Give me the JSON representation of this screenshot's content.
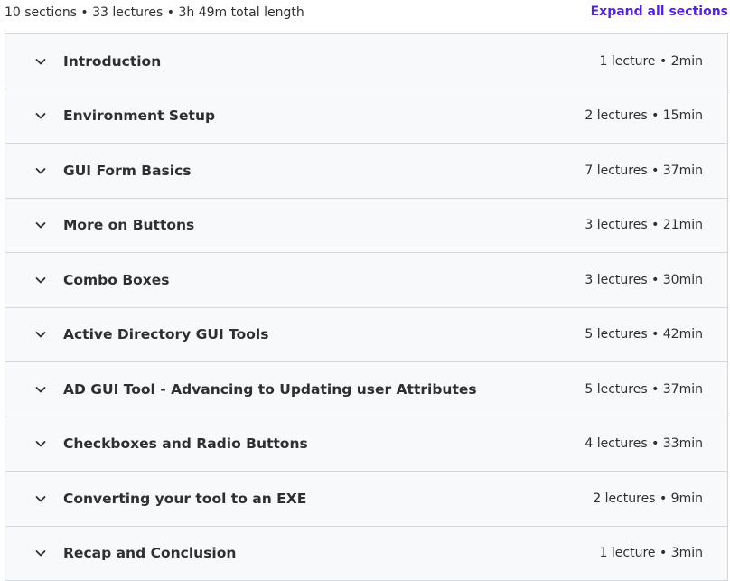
{
  "summary": {
    "text": "10 sections • 33 lectures • 3h 49m total length",
    "expand_label": "Expand all sections"
  },
  "accent_color": "#5624d0",
  "sections": [
    {
      "title": "Introduction",
      "meta": "1 lecture • 2min",
      "icon": "chevron-down-icon"
    },
    {
      "title": "Environment Setup",
      "meta": "2 lectures • 15min",
      "icon": "chevron-down-icon"
    },
    {
      "title": "GUI Form Basics",
      "meta": "7 lectures • 37min",
      "icon": "chevron-down-icon"
    },
    {
      "title": "More on Buttons",
      "meta": "3 lectures • 21min",
      "icon": "chevron-down-icon"
    },
    {
      "title": "Combo Boxes",
      "meta": "3 lectures • 30min",
      "icon": "chevron-down-icon"
    },
    {
      "title": "Active Directory GUI Tools",
      "meta": "5 lectures • 42min",
      "icon": "chevron-down-icon"
    },
    {
      "title": "AD GUI Tool - Advancing to Updating user Attributes",
      "meta": "5 lectures • 37min",
      "icon": "chevron-down-icon"
    },
    {
      "title": "Checkboxes and Radio Buttons",
      "meta": "4 lectures • 33min",
      "icon": "chevron-down-icon"
    },
    {
      "title": "Converting your tool to an EXE",
      "meta": "2 lectures • 9min",
      "icon": "chevron-down-icon"
    },
    {
      "title": "Recap and Conclusion",
      "meta": "1 lecture • 3min",
      "icon": "chevron-down-icon"
    }
  ]
}
